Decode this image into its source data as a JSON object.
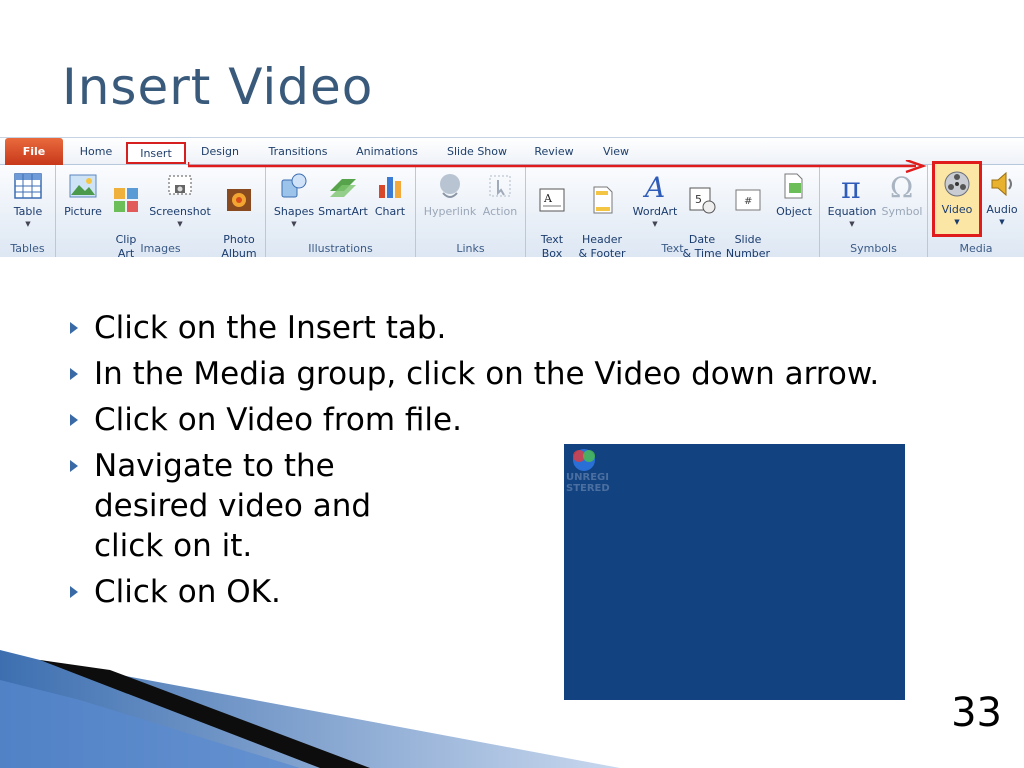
{
  "slide": {
    "title": "Insert Video",
    "number": "33"
  },
  "ribbon": {
    "tabs": [
      "File",
      "Home",
      "Insert",
      "Design",
      "Transitions",
      "Animations",
      "Slide Show",
      "Review",
      "View"
    ],
    "groups": {
      "tables": {
        "label": "Tables",
        "commands": [
          "Table"
        ]
      },
      "images": {
        "label": "Images",
        "commands": [
          "Picture",
          "Clip\nArt",
          "Screenshot",
          "Photo\nAlbum"
        ]
      },
      "illustrations": {
        "label": "Illustrations",
        "commands": [
          "Shapes",
          "SmartArt",
          "Chart"
        ]
      },
      "links": {
        "label": "Links",
        "commands": [
          "Hyperlink",
          "Action"
        ]
      },
      "text": {
        "label": "Text",
        "commands": [
          "Text\nBox",
          "Header\n& Footer",
          "WordArt",
          "Date\n& Time",
          "Slide\nNumber",
          "Object"
        ]
      },
      "symbols": {
        "label": "Symbols",
        "commands": [
          "Equation",
          "Symbol"
        ]
      },
      "media": {
        "label": "Media",
        "commands": [
          "Video",
          "Audio"
        ]
      }
    }
  },
  "bullets": [
    {
      "pre": "Click on the ",
      "bold": "Insert",
      "post": " tab."
    },
    {
      "pre": "In the ",
      "bold": "Media",
      "mid": " group, click on the ",
      "bold2": "Video",
      "post": " down arrow."
    },
    {
      "pre": "Click on ",
      "bold": "Video from file",
      "post": "."
    },
    {
      "pre": "Navigate to the desired video and click on it."
    },
    {
      "pre": "Click on ",
      "bold": "OK",
      "post": "."
    }
  ],
  "media": {
    "watermark_line1": "UNREGI",
    "watermark_line2": "STERED"
  },
  "colors": {
    "title": "#3a5a7c",
    "highlight": "#e01b1b",
    "media_bg": "#12427f"
  }
}
